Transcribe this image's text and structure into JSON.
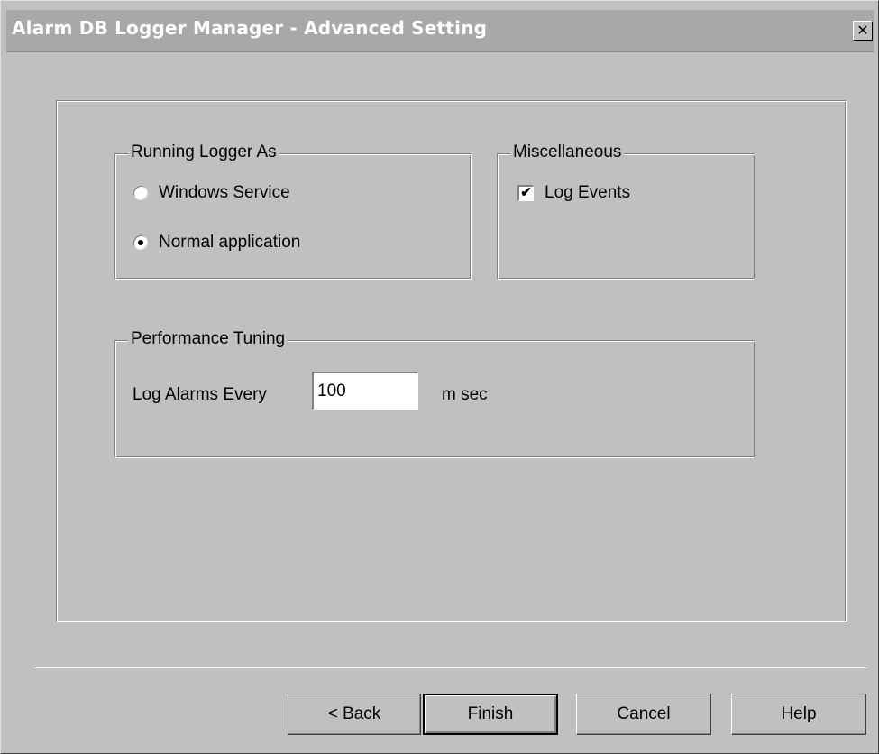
{
  "window": {
    "title": "Alarm DB Logger Manager - Advanced Setting",
    "close_label": "✕"
  },
  "running_as": {
    "legend": "Running Logger As",
    "options": [
      {
        "label": "Windows Service",
        "selected": false
      },
      {
        "label": "Normal application",
        "selected": true
      }
    ]
  },
  "misc": {
    "legend": "Miscellaneous",
    "log_events": {
      "label": "Log Events",
      "checked": true,
      "mark": "✔"
    }
  },
  "performance": {
    "legend": "Performance Tuning",
    "log_alarms_label": "Log Alarms Every",
    "log_alarms_value": "100",
    "unit": "m sec"
  },
  "buttons": {
    "back": "< Back",
    "finish": "Finish",
    "cancel": "Cancel",
    "help": "Help"
  }
}
